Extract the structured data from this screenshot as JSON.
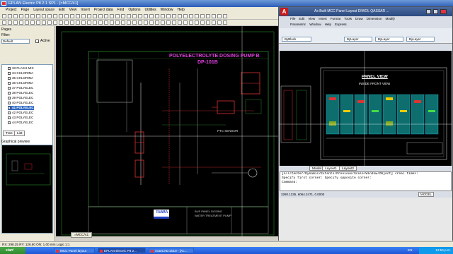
{
  "eplan": {
    "title": "EPLAN Electric P8 2.1 SP1 - [=MCC/41]",
    "menu": [
      "Project",
      "Page",
      "Layout space",
      "Edit",
      "View",
      "Insert",
      "Project data",
      "Find",
      "Options",
      "Utilities",
      "Window",
      "Help"
    ],
    "panel": {
      "pages_label": "Pages",
      "filter_label": "Filter:",
      "filter_value": "Default",
      "active_label": "Active",
      "pages": [
        {
          "label": "33 FLASH MIX",
          "selected": false
        },
        {
          "label": "34 CHLORINA",
          "selected": false
        },
        {
          "label": "35 CHLORINA",
          "selected": false
        },
        {
          "label": "36 CHLORINA",
          "selected": false
        },
        {
          "label": "37 POLYELEC",
          "selected": false
        },
        {
          "label": "38 POLYELEC",
          "selected": false
        },
        {
          "label": "39 POLYELEC",
          "selected": false
        },
        {
          "label": "40 POLYELEC",
          "selected": false
        },
        {
          "label": "41 POLYELEC",
          "selected": true
        },
        {
          "label": "42 POLYELEC",
          "selected": false
        },
        {
          "label": "43 POLYELEC",
          "selected": false
        },
        {
          "label": "44 POLYELEC",
          "selected": false
        }
      ],
      "tab_tree": "Tree",
      "tab_list": "List",
      "preview_label": "Graphical preview"
    },
    "drawing": {
      "title_line1": "POLYELECTROLYTE DOSING PUMP B",
      "title_line2": "DP-101B",
      "sensor_label": "PTC SENSOR",
      "company": "TEWA",
      "block_text1": "BUS PANEL DOSING",
      "block_text2": "WATER TREATMENT PUMP"
    },
    "page_tab": "=MCC/41",
    "status": "RX: 298.25    RY: 126.50        ON: 1.00 mm        Logic 1:1"
  },
  "taskbar": {
    "start_label": "start",
    "items": [
      "MCC Panel layout",
      "EPLAN Electric P8 2...",
      "AutoCAD 2010 - [Ac..."
    ],
    "lang": "EN",
    "clock": "12:54 p.m."
  },
  "autocad": {
    "title": "As Built MCC Panel Layout DIWOL QASSAR ...",
    "menu1": [
      "File",
      "Edit",
      "View",
      "Insert",
      "Format",
      "Tools",
      "Draw",
      "Dimension",
      "Modify"
    ],
    "menu2": [
      "Parametric",
      "Window",
      "Help",
      "Express"
    ],
    "layer_value": "ByBlock",
    "color_value": "ByLayer",
    "linetype_value": "ByLayer",
    "lineweight_value": "ByLayer",
    "panel_title": "PANEL VIEW",
    "panel_subtitle": "INSIDE FRONT VIEW",
    "tabs": [
      "Model",
      "Layout1",
      "Layout2"
    ],
    "cmd_lines": [
      "[All/Center/Dynamic/Extents/Previous/Scale/Window/Object] <real time>:",
      "Specify first corner: Specify opposite corner:",
      "Command:"
    ],
    "coords": "3280.1335, 6064.2471, 0.0000",
    "model_label": "MODEL"
  }
}
